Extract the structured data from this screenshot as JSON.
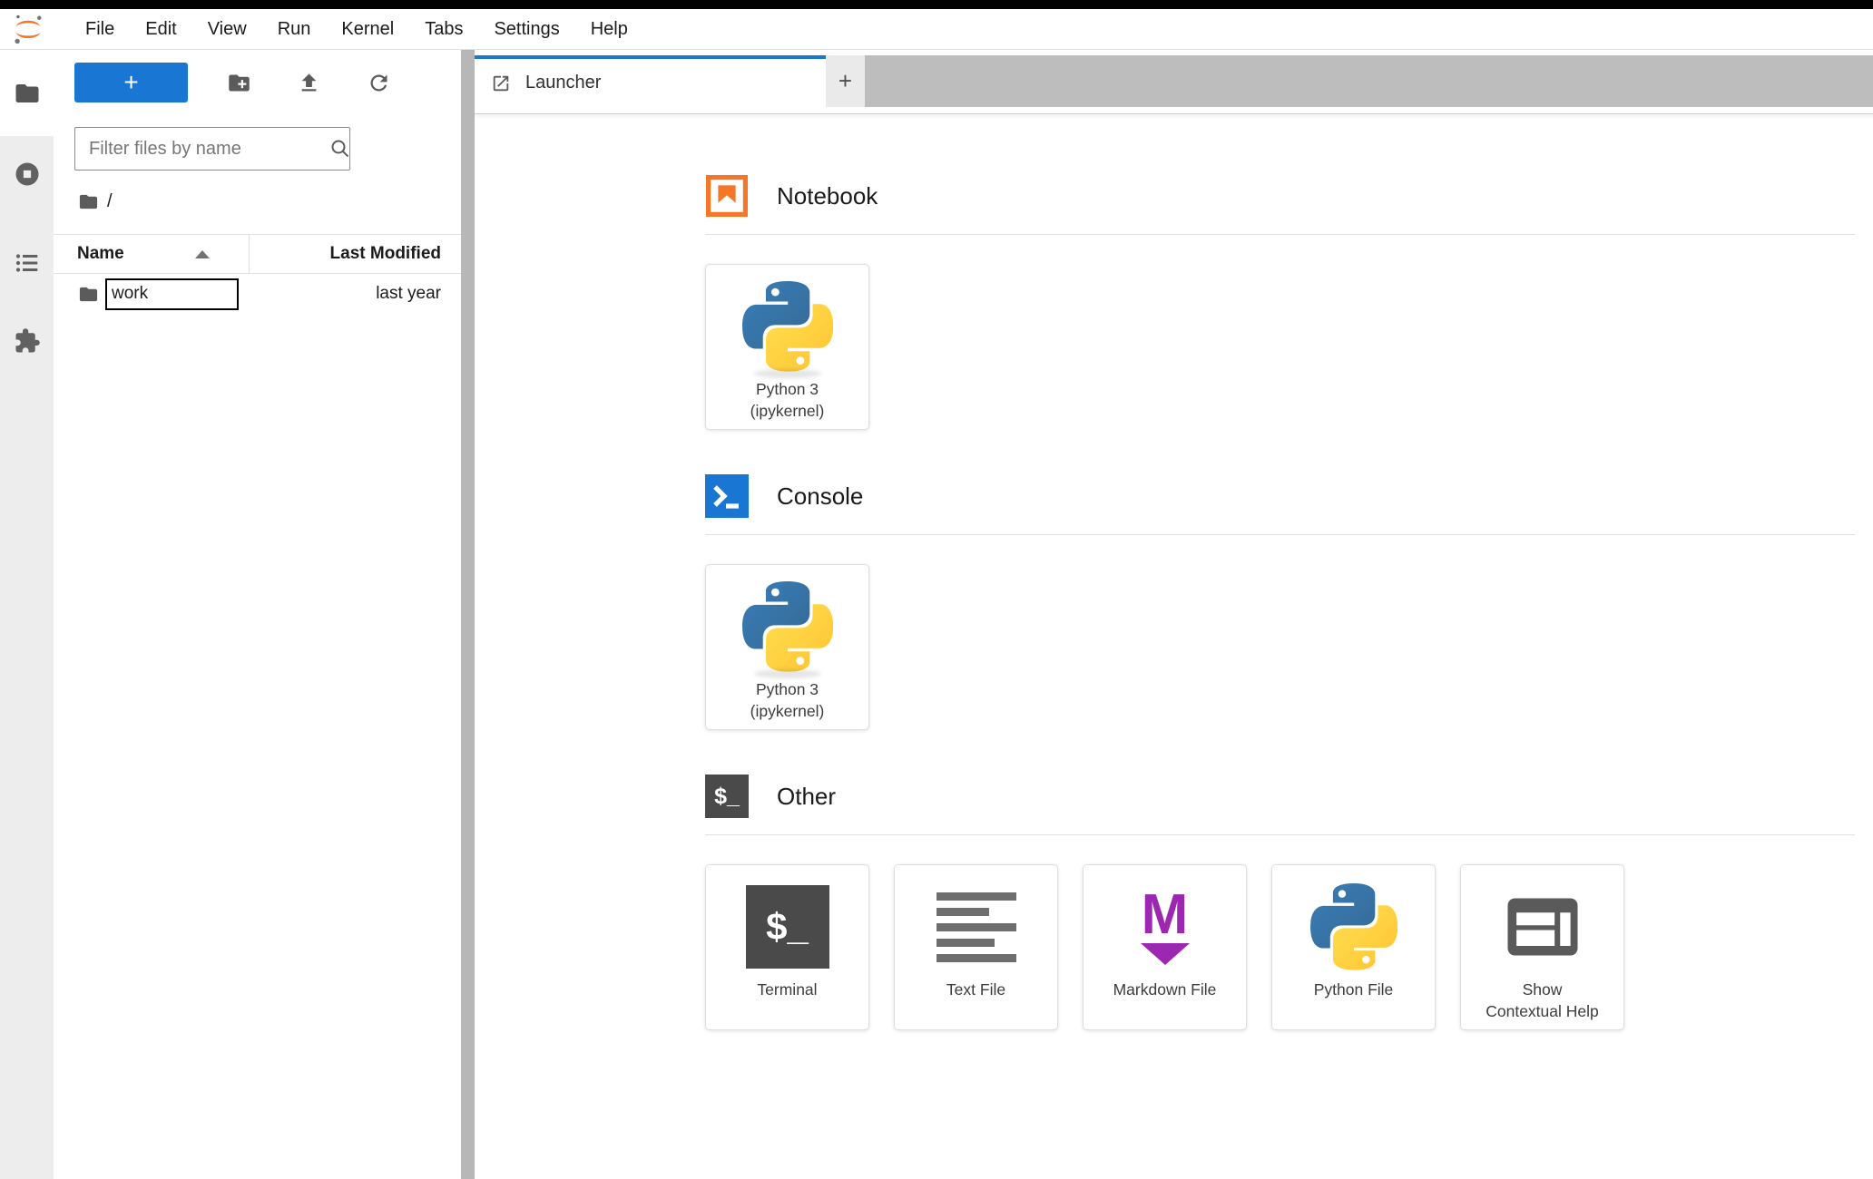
{
  "menu_bar": {
    "items": [
      "File",
      "Edit",
      "View",
      "Run",
      "Kernel",
      "Tabs",
      "Settings",
      "Help"
    ]
  },
  "file_browser": {
    "new_launcher_label": "+",
    "filter_placeholder": "Filter files by name",
    "breadcrumb_root": "/",
    "columns": {
      "name": "Name",
      "last_modified": "Last Modified"
    },
    "rows": [
      {
        "name": "work",
        "last_modified": "last year",
        "renaming": true
      }
    ]
  },
  "tab_bar": {
    "tabs": [
      {
        "label": "Launcher",
        "active": true
      }
    ],
    "new_tab_label": "+"
  },
  "launcher": {
    "sections": [
      {
        "title": "Notebook",
        "cards": [
          {
            "label_line1": "Python 3",
            "label_line2": "(ipykernel)"
          }
        ]
      },
      {
        "title": "Console",
        "cards": [
          {
            "label_line1": "Python 3",
            "label_line2": "(ipykernel)"
          }
        ]
      },
      {
        "title": "Other",
        "cards": [
          {
            "label_line1": "Terminal",
            "label_line2": ""
          },
          {
            "label_line1": "Text File",
            "label_line2": ""
          },
          {
            "label_line1": "Markdown File",
            "label_line2": ""
          },
          {
            "label_line1": "Python File",
            "label_line2": ""
          },
          {
            "label_line1": "Show",
            "label_line2": "Contextual Help"
          }
        ]
      }
    ]
  },
  "glyphs": {
    "terminal": "$_",
    "markdown_m": "M"
  },
  "colors": {
    "brand_blue": "#1976d2",
    "jupyter_orange": "#f37726",
    "markdown_purple": "#9c27b0",
    "tabbar_gray": "#bdbdbd",
    "icon_gray": "#5b5b5b"
  }
}
